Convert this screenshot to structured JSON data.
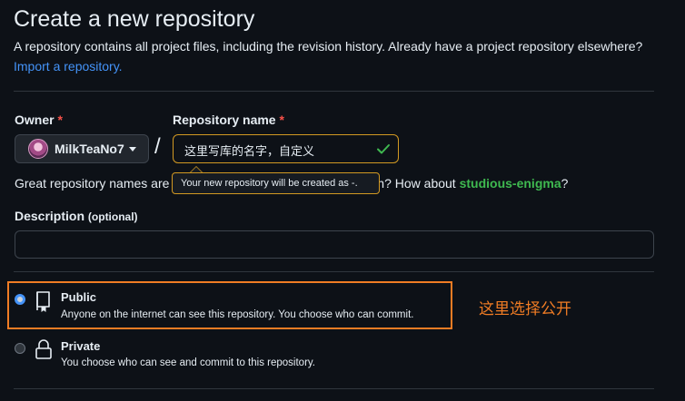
{
  "header": {
    "title": "Create a new repository",
    "description": "A repository contains all project files, including the revision history. Already have a project repository elsewhere?",
    "import_link": "Import a repository."
  },
  "owner": {
    "label": "Owner",
    "required_mark": "*",
    "name": "MilkTeaNo7"
  },
  "repo": {
    "slash": "/",
    "label": "Repository name",
    "required_mark": "*",
    "value": "这里写库的名字，自定义",
    "tooltip": "Your new repository will be created as -.",
    "great_prefix": "Great repository names are s",
    "great_middle": "n? How about ",
    "suggestion": "studious-enigma",
    "great_suffix": "?"
  },
  "description": {
    "label": "Description",
    "optional": "(optional)",
    "value": ""
  },
  "visibility": {
    "public": {
      "title": "Public",
      "desc": "Anyone on the internet can see this repository. You choose who can commit.",
      "checked": true
    },
    "private": {
      "title": "Private",
      "desc": "You choose who can see and commit to this repository.",
      "checked": false
    }
  },
  "annotation": "这里选择公开",
  "colors": {
    "background": "#0d1117",
    "link": "#4493f8",
    "success": "#3fb950",
    "warning_border": "#d29922",
    "annotation": "#f07c24"
  }
}
